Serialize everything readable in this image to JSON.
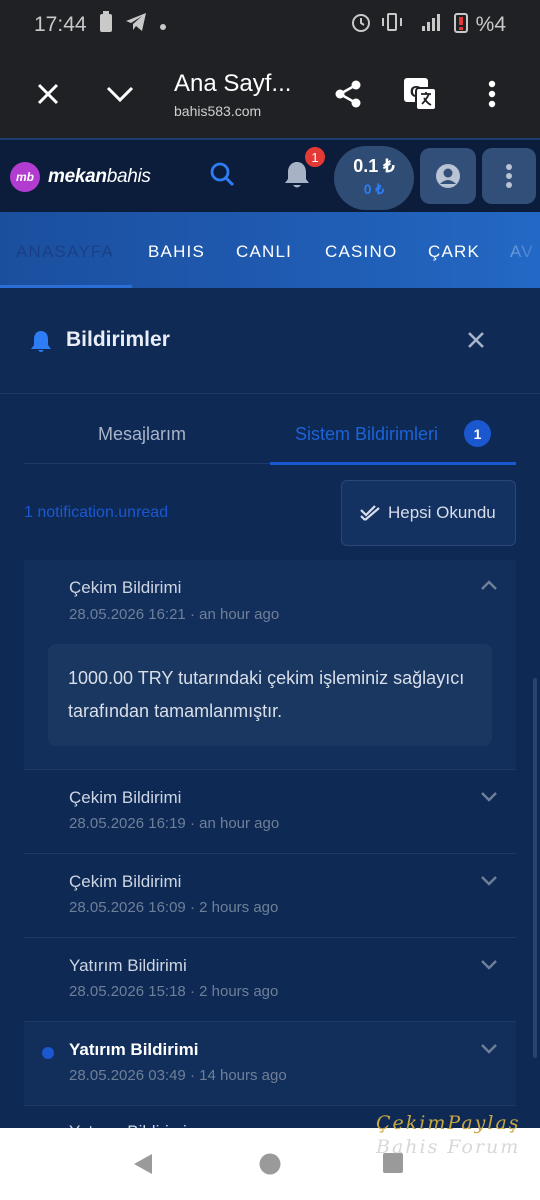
{
  "status_bar": {
    "time": "17:44",
    "battery": "%4"
  },
  "browser": {
    "page_title": "Ana Sayf...",
    "url": "bahis583.com"
  },
  "header": {
    "logo_badge": "mb",
    "logo_bold": "mekan",
    "logo_light": "bahis",
    "notification_count": "1",
    "balance_main": "0.1 ₺",
    "balance_bonus": "0 ₺"
  },
  "nav": {
    "items": [
      "ANASAYFA",
      "BAHIS",
      "CANLI",
      "CASINO",
      "ÇARK",
      "AV"
    ]
  },
  "panel": {
    "title": "Bildirimler",
    "tabs": [
      "Mesajlarım",
      "Sistem Bildirimleri"
    ],
    "tab_badge": "1",
    "unread_label": "1 notification.unread",
    "read_all_label": "Hepsi Okundu"
  },
  "notifications": [
    {
      "title": "Çekim Bildirimi",
      "date": "28.05.2026 16:21",
      "ago": "an hour ago",
      "body": "1000.00 TRY tutarındaki çekim işleminiz sağlayıcı tarafından tamamlanmıştır."
    },
    {
      "title": "Çekim Bildirimi",
      "date": "28.05.2026 16:19",
      "ago": "an hour ago"
    },
    {
      "title": "Çekim Bildirimi",
      "date": "28.05.2026 16:09",
      "ago": "2 hours ago"
    },
    {
      "title": "Yatırım Bildirimi",
      "date": "28.05.2026 15:18",
      "ago": "2 hours ago"
    },
    {
      "title": "Yatırım Bildirimi",
      "date": "28.05.2026 03:49",
      "ago": "14 hours ago"
    },
    {
      "title": "Yatırım Bildirimi"
    }
  ],
  "watermark": {
    "line1": "ÇekimPaylaş",
    "line2": "Bahis Forum"
  },
  "colors": {
    "accent": "#1b57cf",
    "header_bg": "#0b1d3a",
    "panel_bg": "#0e2a54",
    "badge_red": "#e53935"
  }
}
